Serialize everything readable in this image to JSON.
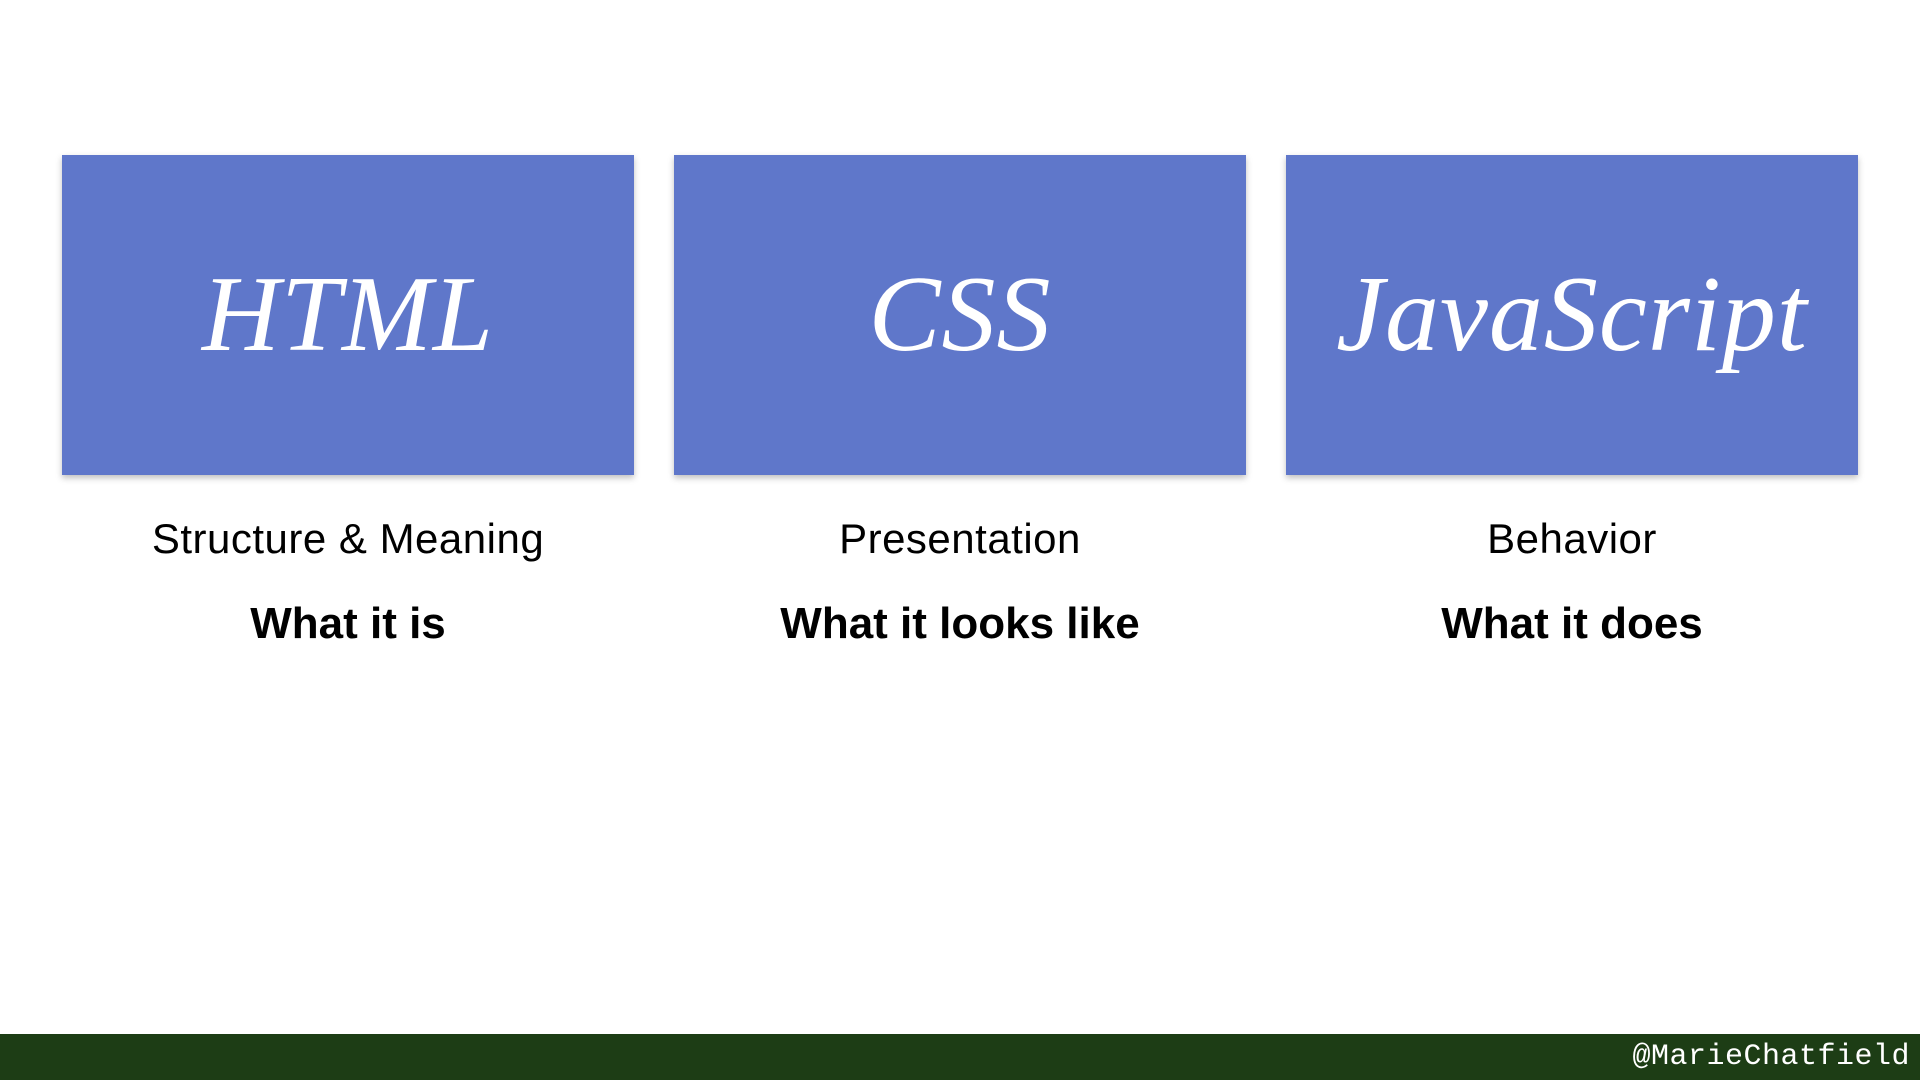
{
  "columns": [
    {
      "title": "HTML",
      "subtitle": "Structure & Meaning",
      "tagline": "What it is"
    },
    {
      "title": "CSS",
      "subtitle": "Presentation",
      "tagline": "What it looks like"
    },
    {
      "title": "JavaScript",
      "subtitle": "Behavior",
      "tagline": "What it does"
    }
  ],
  "footer": {
    "handle": "@MarieChatfield"
  }
}
